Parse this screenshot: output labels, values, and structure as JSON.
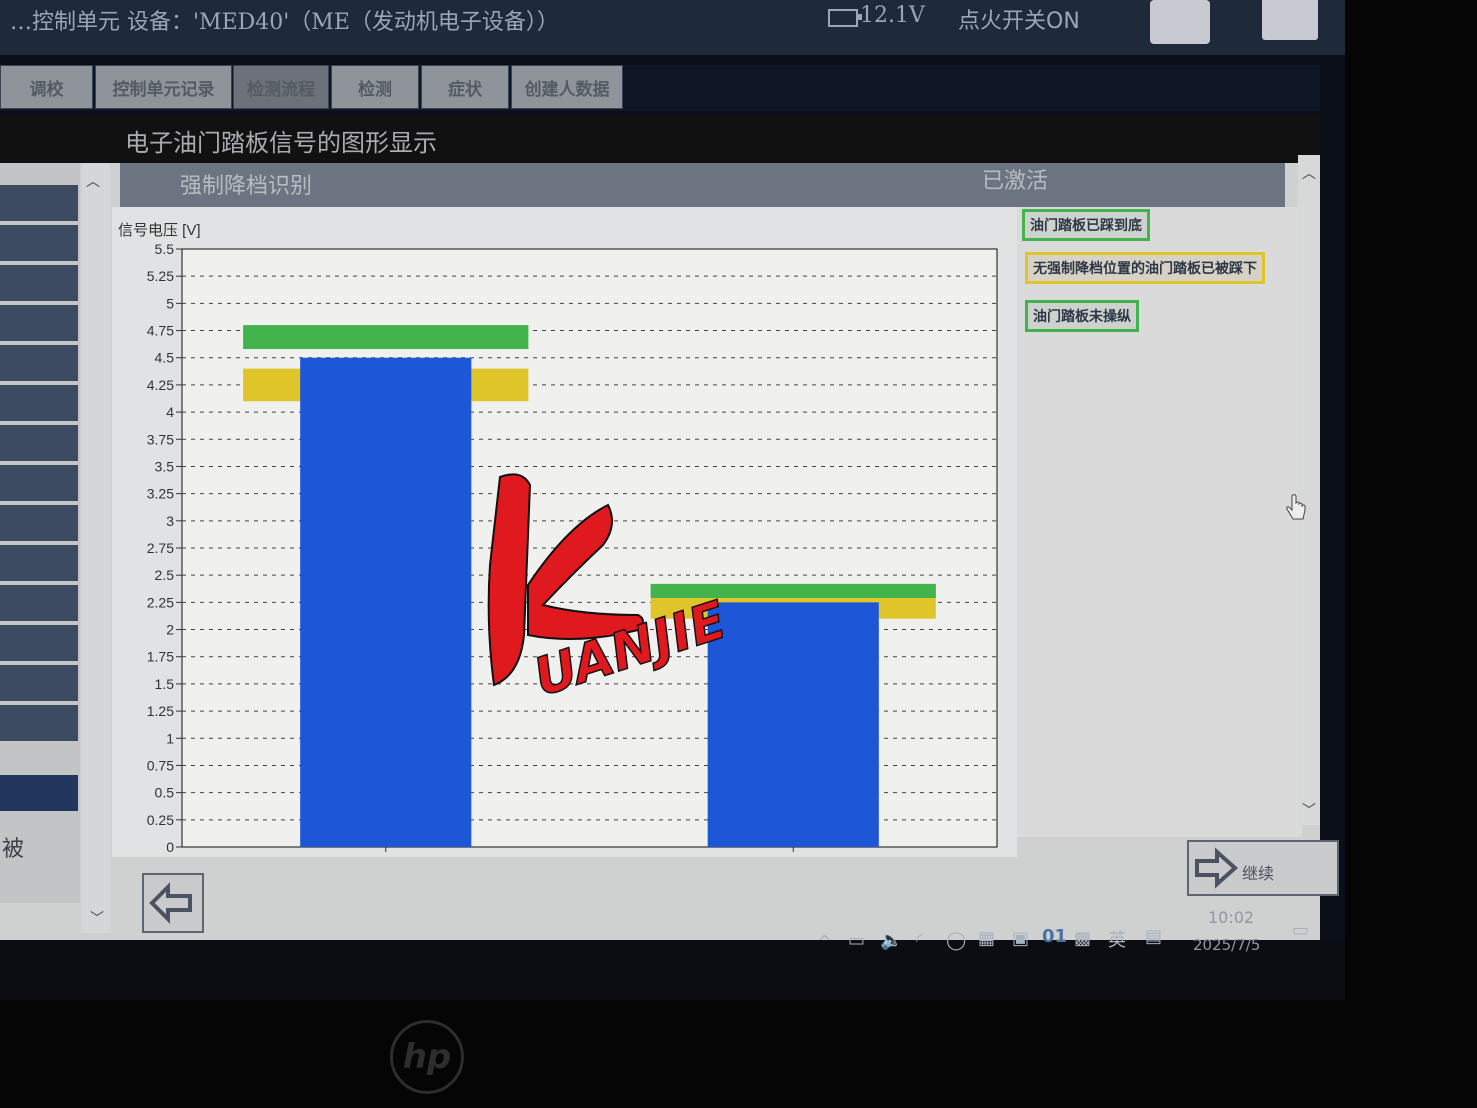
{
  "titlebar": {
    "device": "…控制单元 设备：'MED40'（ME（发动机电子设备））",
    "voltage": "12.1V",
    "ignition": "点火开关ON"
  },
  "tabs": [
    {
      "label": "调校"
    },
    {
      "label": "控制单元记录"
    },
    {
      "label": "检测流程"
    },
    {
      "label": "检测"
    },
    {
      "label": "症状"
    },
    {
      "label": "创建人数据"
    }
  ],
  "page_title": "电子油门踏板信号的图形显示",
  "section": {
    "label": "强制降档识别",
    "status": "已激活"
  },
  "left_partial_text": "被",
  "legend": {
    "items": [
      {
        "label": "油门踏板已踩到底",
        "color": "#43b34b"
      },
      {
        "label": "无强制降档位置的油门踏板已被踩下",
        "color": "#e0c52a"
      },
      {
        "label": "油门踏板未操纵",
        "color": "#43b34b"
      }
    ]
  },
  "chart_data": {
    "type": "bar",
    "ylabel": "信号电压 [V]",
    "ylim": [
      0,
      5.5
    ],
    "yticks": [
      "0",
      "0.25",
      "0.5",
      "0.75",
      "1",
      "1.25",
      "1.5",
      "1.75",
      "2",
      "2.25",
      "2.5",
      "2.75",
      "3",
      "3.25",
      "3.5",
      "3.75",
      "4",
      "4.25",
      "4.5",
      "4.75",
      "5",
      "5.25",
      "5.5"
    ],
    "series": [
      {
        "values": [
          4.5,
          2.25
        ],
        "color": "#1e56d8"
      }
    ],
    "thresholds": [
      {
        "color": "#43b34b",
        "values": [
          [
            4.58,
            4.8
          ],
          [
            2.29,
            2.42
          ]
        ]
      },
      {
        "color": "#e0c52a",
        "values": [
          [
            4.1,
            4.4
          ],
          [
            2.1,
            2.29
          ]
        ]
      }
    ],
    "grid": true
  },
  "nav": {
    "next_label": "继续"
  },
  "taskbar": {
    "ime": "英",
    "time": "10:02",
    "date": "2025/7/5"
  },
  "watermark_text": "UANJIE",
  "brand": "hp"
}
